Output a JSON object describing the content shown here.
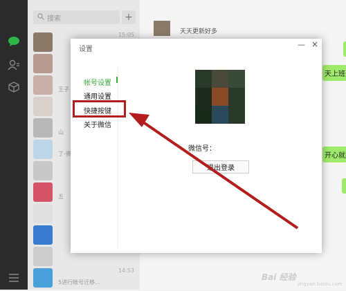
{
  "search": {
    "placeholder": "搜索"
  },
  "add_button": "+",
  "chat_list": [
    {
      "time": "15:05",
      "snippet": "",
      "color": "#8a7a6a"
    },
    {
      "time": "",
      "snippet": "",
      "color": "#b89a90"
    },
    {
      "time": "",
      "snippet": "王子",
      "color": "#c8b0a8"
    },
    {
      "time": "",
      "snippet": "",
      "color": "#d8d0cc"
    },
    {
      "time": "",
      "snippet": "山",
      "color": "#b8b8b8"
    },
    {
      "time": "",
      "snippet": "了-资",
      "color": "#bcd6e8"
    },
    {
      "time": "",
      "snippet": "",
      "color": "#c8c8c8"
    },
    {
      "time": "",
      "snippet": "五",
      "color": "#d6546a"
    },
    {
      "time": "",
      "snippet": "",
      "color": "#e0e0e0"
    },
    {
      "time": "",
      "snippet": "",
      "color": "#3a7ad0"
    },
    {
      "time": "",
      "snippet": "",
      "color": "#cccccc"
    },
    {
      "time": "14:53",
      "snippet": "5进行帐号迁移...",
      "color": "#4aa0d8"
    }
  ],
  "chat": {
    "top_text": "天天更新好多",
    "bubbles": [
      "天上班去",
      "开心就别",
      "",
      ""
    ]
  },
  "dialog": {
    "title": "设置",
    "minimize": "—",
    "close": "×",
    "nav": [
      "帐号设置",
      "通用设置",
      "快捷按键",
      "关于微信"
    ],
    "wechat_id_label": "微信号：",
    "logout_label": "退出登录",
    "profile_colors": [
      "#2a3a2a",
      "#4a4a3a",
      "#3a4a3a",
      "#1f2a1f",
      "#8a4a2a",
      "#2a3a2a",
      "#1a2a1a",
      "#2a4a5a",
      "#2a3a2a"
    ]
  },
  "watermark": {
    "logo": "Bai 经验",
    "sub": "jingyan.baidu.com"
  },
  "colors": {
    "accent": "#3aaa35",
    "annotation": "#b31d1d"
  }
}
